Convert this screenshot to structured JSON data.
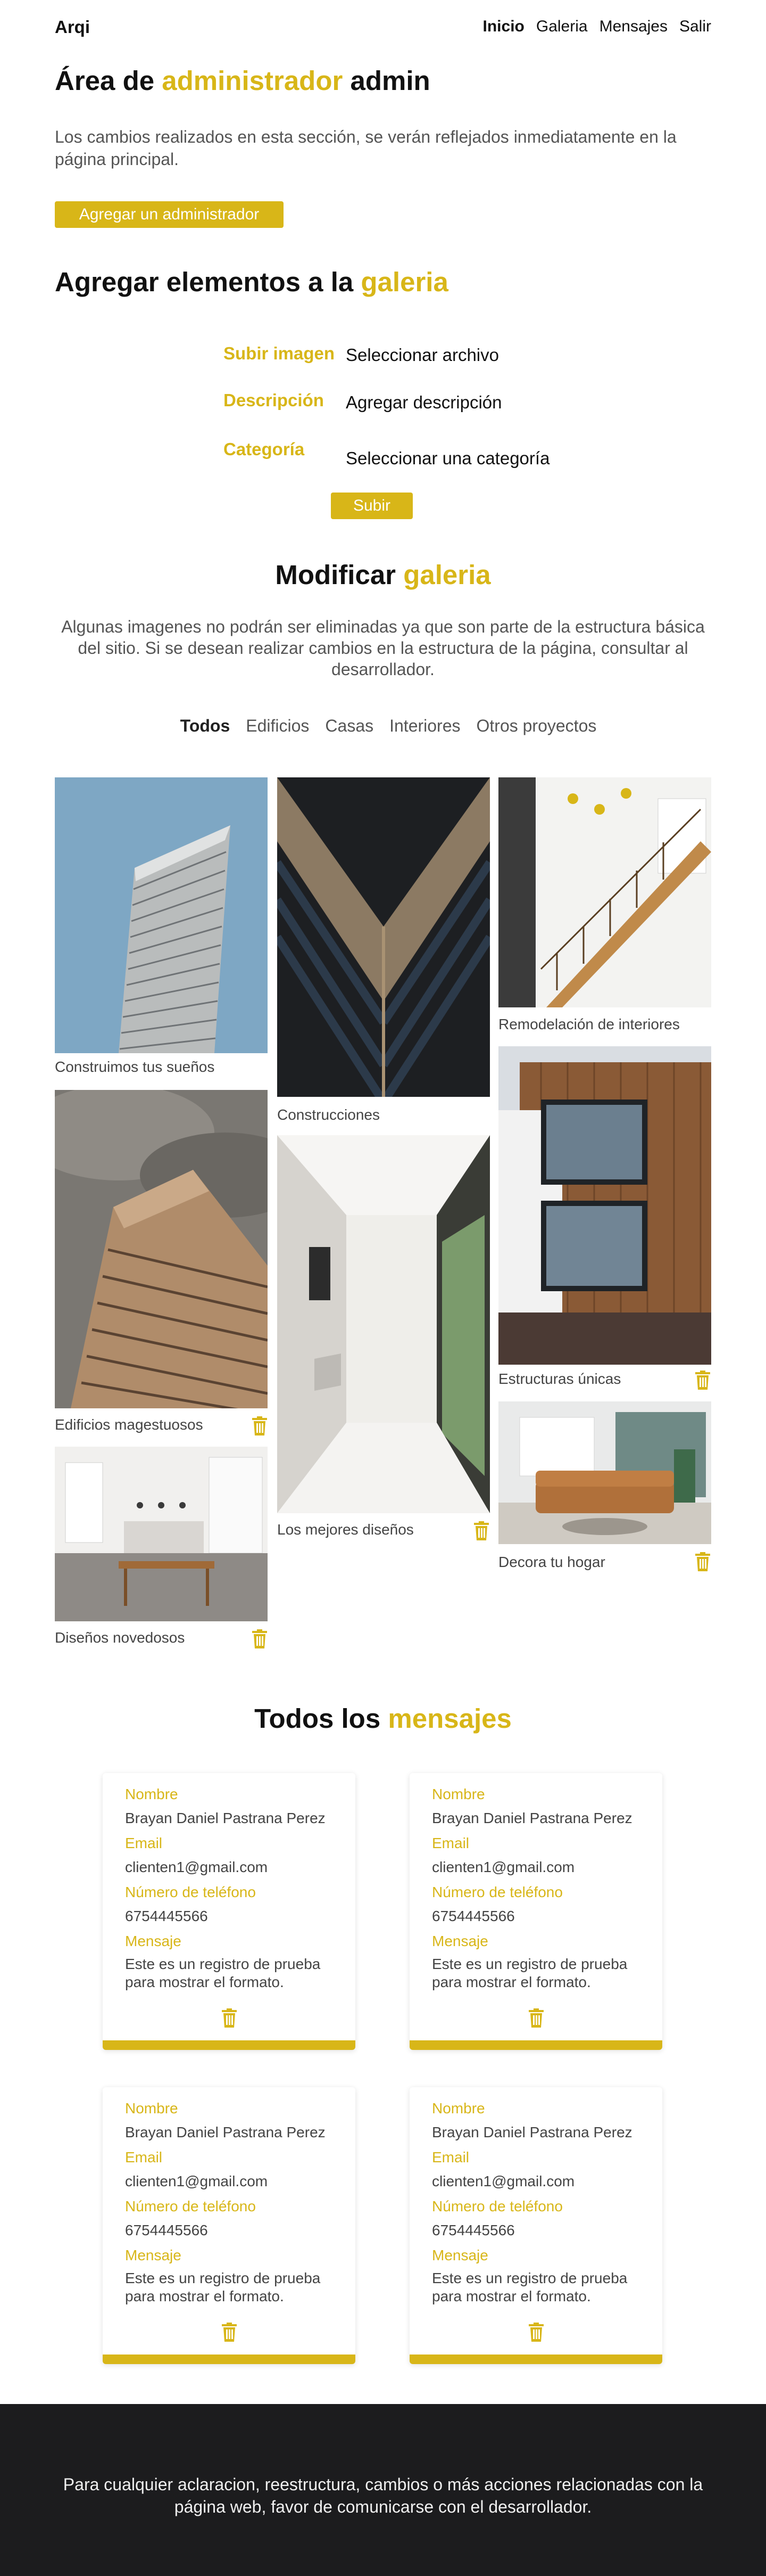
{
  "nav": {
    "brand": "Arqi",
    "links": [
      "Inicio",
      "Galeria",
      "Mensajes",
      "Salir"
    ]
  },
  "admin": {
    "title_prefix": "Área de",
    "title_accent": "administrador",
    "title_suffix": "admin",
    "intro": "Los cambios realizados en esta sección, se verán reflejados inmediatamente en la página principal.",
    "add_button": "Agregar un administrador"
  },
  "gallery_form": {
    "title_prefix": "Agregar elementos a la",
    "title_accent": "galeria",
    "upload_label": "Subir imagen",
    "upload_value": "Seleccionar archivo",
    "desc_label": "Descripción",
    "desc_placeholder": "Agregar descripción",
    "category_label": "Categoría",
    "category_value": "Seleccionar una categoría",
    "submit": "Subir"
  },
  "modify": {
    "title_prefix": "Modificar",
    "title_accent": "galeria",
    "description": "Algunas imagenes no podrán ser eliminadas ya que  son parte de la estructura básica del sitio. Si se desean realizar cambios en la estructura de la página, consultar al desarrollador.",
    "filters": [
      "Todos",
      "Edificios",
      "Casas",
      "Interiores",
      "Otros proyectos"
    ],
    "captions": {
      "c1": "Construimos tus sueños",
      "c2": "Edificios magestuosos",
      "c3": "Diseños novedosos",
      "c4": "Construcciones",
      "c5": "Los mejores diseños",
      "c6": "Remodelación de interiores",
      "c7": "Estructuras únicas",
      "c8": "Decora tu hogar"
    }
  },
  "messages": {
    "title_prefix": "Todos los",
    "title_accent": "mensajes",
    "labels": {
      "name": "Nombre",
      "email": "Email",
      "phone": "Número de teléfono",
      "message": "Mensaje"
    },
    "items": [
      {
        "name": "Brayan Daniel Pastrana Perez",
        "email": "clienten1@gmail.com",
        "phone": "6754445566",
        "message": "Este es un registro de prueba para mostrar el formato."
      },
      {
        "name": "Brayan Daniel Pastrana Perez",
        "email": "clienten1@gmail.com",
        "phone": "6754445566",
        "message": "Este es un registro de prueba para mostrar el formato."
      },
      {
        "name": "Brayan Daniel Pastrana Perez",
        "email": "clienten1@gmail.com",
        "phone": "6754445566",
        "message": "Este es un registro de prueba para mostrar el formato."
      },
      {
        "name": "Brayan Daniel Pastrana Perez",
        "email": "clienten1@gmail.com",
        "phone": "6754445566",
        "message": "Este es un registro de prueba para mostrar el formato."
      }
    ]
  },
  "footer": {
    "text": "Para cualquier aclaracion, reestructura, cambios o más acciones relacionadas con la página web, favor de comunicarse con el desarrollador."
  },
  "colors": {
    "accent": "#d8b618",
    "footer_bg": "#1c1c1e"
  }
}
